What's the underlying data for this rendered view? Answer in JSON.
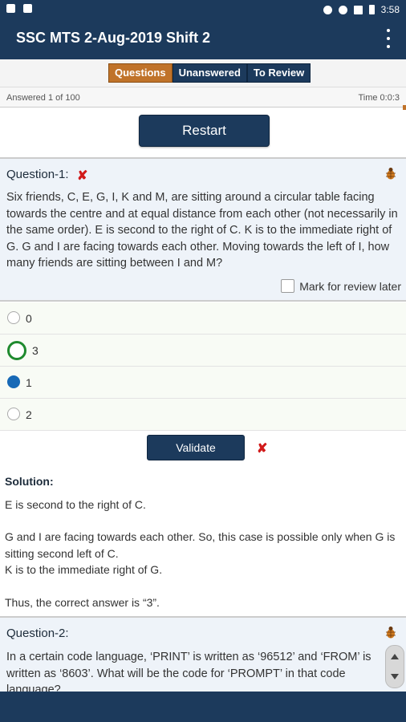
{
  "status_bar": {
    "time": "3:58"
  },
  "app_bar": {
    "title": "SSC MTS 2-Aug-2019 Shift 2"
  },
  "tabs": [
    {
      "label": "Questions",
      "active": true
    },
    {
      "label": "Unanswered",
      "active": false
    },
    {
      "label": "To Review",
      "active": false
    }
  ],
  "meta": {
    "answered": "Answered 1 of 100",
    "timer": "Time 0:0:3"
  },
  "restart_label": "Restart",
  "question1": {
    "heading": "Question-1:",
    "text": "Six friends, C, E, G, I, K and M, are sitting around a circular table facing towards the centre and at equal distance from each other (not necessarily in the same order). E is second to the right of C. K is to the immediate right of G. G and I are facing towards each other. Moving towards the left of I, how many friends are sitting between I and M?",
    "review_label": "Mark for review later",
    "status": "wrong"
  },
  "options": [
    {
      "label": "0",
      "state": "none"
    },
    {
      "label": "3",
      "state": "correct"
    },
    {
      "label": "1",
      "state": "chosen"
    },
    {
      "label": "2",
      "state": "none"
    }
  ],
  "validate_label": "Validate",
  "solution": {
    "heading": "Solution:",
    "line1": "E is second to the right of C.",
    "line2": "G and I are facing towards each other. So, this case is possible only when G is sitting second left of C.",
    "line3": "K is to the immediate right of G.",
    "line4": "Thus, the correct answer is “3”."
  },
  "question2": {
    "heading": "Question-2:",
    "text": "In a certain code language, ‘PRINT’ is written as ‘96512’ and ‘FROM’ is written as ‘8603’. What will be the code for ‘PROMPT’ in that code language?"
  },
  "colors": {
    "primary": "#1c3a5c",
    "accent": "#c0732a",
    "wrong": "#d11a1a",
    "correct": "#1f8a2e",
    "chosen": "#1769b6"
  }
}
